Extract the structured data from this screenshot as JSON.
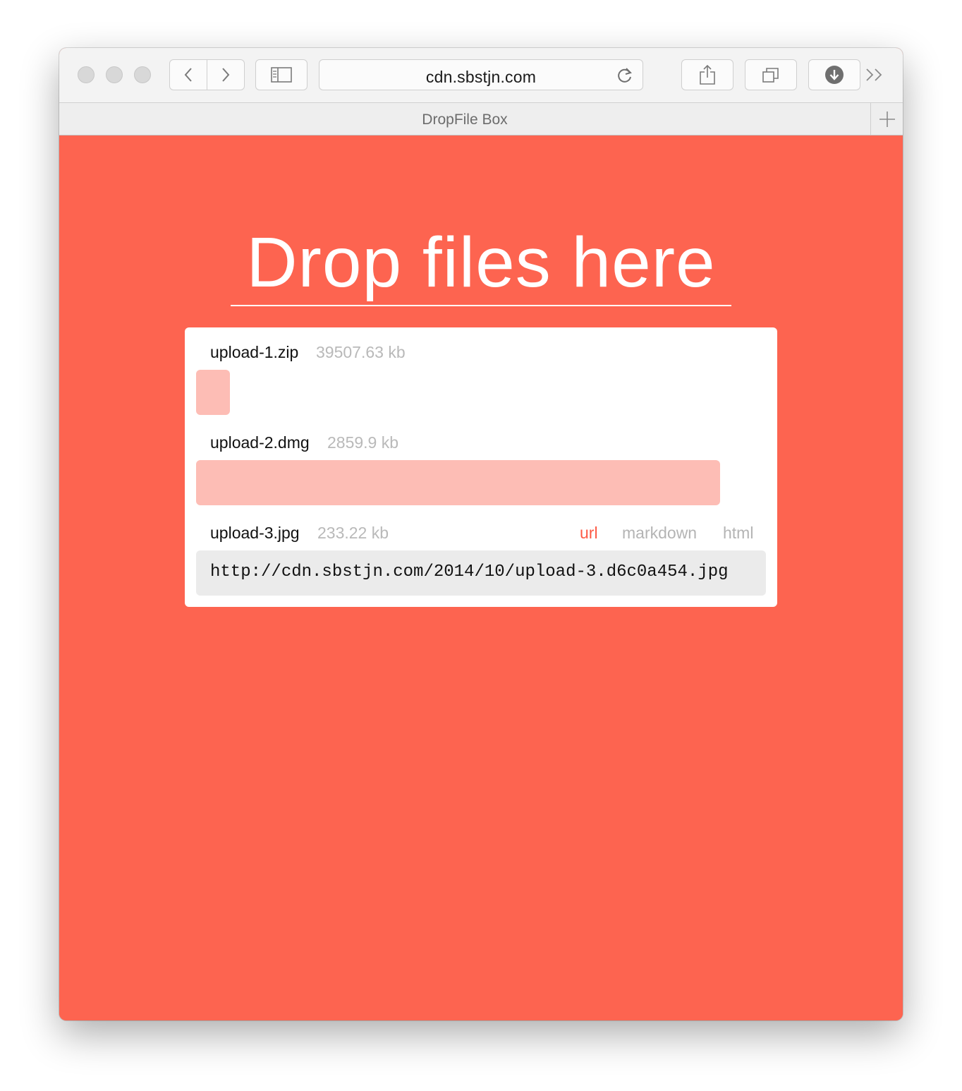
{
  "browser": {
    "address": "cdn.sbstjn.com",
    "tab_title": "DropFile Box"
  },
  "page": {
    "drop_label": "Drop files here",
    "accent_color": "#fd6450",
    "progress_color": "#fdbdb5"
  },
  "uploads": [
    {
      "name": "upload-1.zip",
      "size": "39507.63 kb",
      "progress_percent": 6
    },
    {
      "name": "upload-2.dmg",
      "size": "2859.9 kb",
      "progress_percent": 92
    },
    {
      "name": "upload-3.jpg",
      "size": "233.22 kb",
      "formats": [
        "url",
        "markdown",
        "html"
      ],
      "active_format": "url",
      "link": "http://cdn.sbstjn.com/2014/10/upload-3.d6c0a454.jpg"
    }
  ]
}
